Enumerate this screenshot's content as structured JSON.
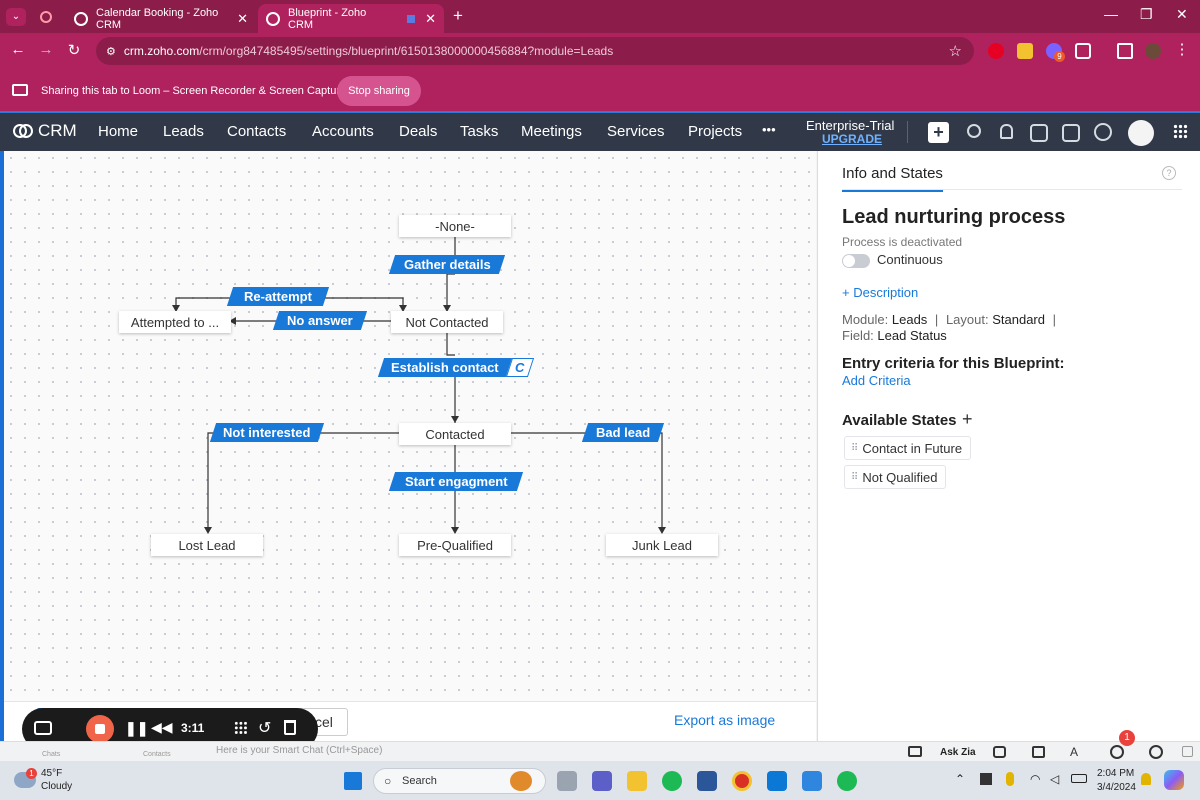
{
  "browser": {
    "tabs": [
      {
        "title": "Calendar Booking - Zoho CRM",
        "active": false
      },
      {
        "title": "Blueprint - Zoho CRM",
        "active": true
      }
    ],
    "new_tab": "+",
    "url_main": "crm.zoho.com",
    "url_rest": "/crm/org847485495/settings/blueprint/6150138000000456884?module=Leads",
    "extension_badge": "9"
  },
  "share_bar": {
    "message": "Sharing this tab to Loom – Screen Recorder & Screen Capture",
    "stop_button": "Stop sharing"
  },
  "crm_nav": {
    "logo": "CRM",
    "items": [
      "Home",
      "Leads",
      "Contacts",
      "Accounts",
      "Deals",
      "Tasks",
      "Meetings",
      "Services",
      "Projects",
      "•••"
    ],
    "plan": "Enterprise-Trial",
    "upgrade": "UPGRADE"
  },
  "blueprint": {
    "states": {
      "none": "-None-",
      "not_contacted": "Not Contacted",
      "attempted": "Attempted to ...",
      "contacted": "Contacted",
      "lost": "Lost Lead",
      "prequalified": "Pre-Qualified",
      "junk": "Junk Lead"
    },
    "transitions": {
      "gather": "Gather details",
      "reattempt": "Re-attempt",
      "no_answer": "No answer",
      "establish": "Establish contact",
      "establish_tag": "C",
      "not_interested": "Not interested",
      "bad_lead": "Bad lead",
      "start": "Start engagment"
    }
  },
  "panel": {
    "tab": "Info and States",
    "help": "?",
    "title": "Lead nurturing process",
    "status": "Process is deactivated",
    "toggle_label": "Continuous",
    "toggle_on": false,
    "description_link": "+ Description",
    "module_label": "Module:",
    "module_value": "Leads",
    "layout_label": "Layout:",
    "layout_value": "Standard",
    "field_label": "Field:",
    "field_value": "Lead Status",
    "sep": "|",
    "entry_heading": "Entry criteria for this Blueprint:",
    "add_criteria": "Add Criteria",
    "states_heading": "Available States",
    "add_state": "+",
    "available_states": [
      "Contact in Future",
      "Not Qualified"
    ]
  },
  "actions": {
    "cancel_fragment": "cel",
    "export": "Export as image"
  },
  "loom": {
    "timer": "3:11"
  },
  "bottom_bar": {
    "chats": "Chats",
    "contacts": "Contacts",
    "smart_chat": "Here is your Smart Chat (Ctrl+Space)",
    "ask_zia": "Ask Zia",
    "notif_count": "1"
  },
  "taskbar": {
    "temp": "45°F",
    "weather": "Cloudy",
    "weather_badge": "1",
    "search": "Search",
    "time": "2:04 PM",
    "date": "3/4/2024"
  }
}
